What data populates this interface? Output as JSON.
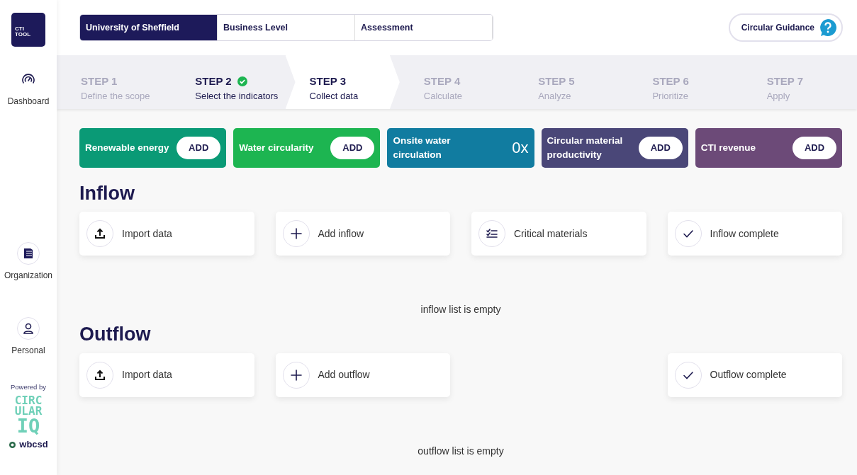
{
  "sidebar": {
    "logo": [
      "CTI",
      "TOOL"
    ],
    "items": [
      {
        "label": "Dashboard"
      },
      {
        "label": "Organization"
      },
      {
        "label": "Personal"
      }
    ],
    "powered_by": "Powered by",
    "brand": [
      "CIRC",
      "ULAR",
      "IQ"
    ],
    "partner": "wbcsd"
  },
  "breadcrumb": [
    {
      "label": "University of Sheffield",
      "selected": true
    },
    {
      "label": "Business Level",
      "selected": false
    },
    {
      "label": "Assessment",
      "selected": false
    }
  ],
  "guidance_button": {
    "label": "Circular Guidance"
  },
  "steps": [
    {
      "title": "STEP 1",
      "subtitle": "Define the scope",
      "selected": false,
      "completed": false
    },
    {
      "title": "STEP 2",
      "subtitle": "Select the indicators",
      "selected": false,
      "completed": true
    },
    {
      "title": "STEP 3",
      "subtitle": "Collect data",
      "selected": true,
      "completed": false
    },
    {
      "title": "STEP 4",
      "subtitle": "Calculate",
      "selected": false,
      "completed": false
    },
    {
      "title": "STEP 5",
      "subtitle": "Analyze",
      "selected": false,
      "completed": false
    },
    {
      "title": "STEP 6",
      "subtitle": "Prioritize",
      "selected": false,
      "completed": false
    },
    {
      "title": "STEP 7",
      "subtitle": "Apply",
      "selected": false,
      "completed": false
    }
  ],
  "indicators": [
    {
      "label": "Renewable energy",
      "color": "#0a9a76",
      "kind": "add",
      "action": "ADD"
    },
    {
      "label": "Water circularity",
      "color": "#1db551",
      "kind": "add",
      "action": "ADD"
    },
    {
      "label": "Onsite water circulation",
      "color": "#117ca0",
      "kind": "value",
      "value": "0x"
    },
    {
      "label": "Circular material productivity",
      "color": "#4a4778",
      "kind": "add",
      "action": "ADD"
    },
    {
      "label": "CTI revenue",
      "color": "#6c4a78",
      "kind": "add",
      "action": "ADD"
    }
  ],
  "sections": [
    {
      "title": "Inflow",
      "actions": [
        {
          "label": "Import data",
          "kind": "import"
        },
        {
          "label": "Add inflow",
          "kind": "add"
        },
        {
          "label": "Critical materials",
          "kind": "list"
        },
        {
          "label": "Inflow complete",
          "kind": "complete"
        }
      ],
      "empty_text": "inflow list is empty"
    },
    {
      "title": "Outflow",
      "actions": [
        {
          "label": "Import data",
          "kind": "import"
        },
        {
          "label": "Add outflow",
          "kind": "add"
        },
        {
          "label": "Outflow complete",
          "kind": "complete"
        }
      ],
      "empty_text": "outflow list is empty"
    }
  ]
}
